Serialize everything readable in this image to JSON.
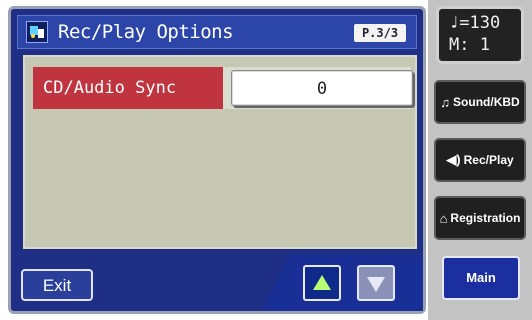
{
  "screen": {
    "title": "Rec/Play Options",
    "page_indicator": "P.3/3",
    "title_icon": "recorder-icon"
  },
  "params": [
    {
      "label": "CD/Audio Sync",
      "value": "0"
    }
  ],
  "bottom": {
    "exit_label": "Exit",
    "up_icon": "arrow-up-icon",
    "down_icon": "arrow-down-icon"
  },
  "side": {
    "tempo": "♩=130",
    "measure": "M:   1",
    "buttons": [
      {
        "label": "Sound/KBD",
        "icon": "♫"
      },
      {
        "label": "Rec/Play",
        "icon": "◀)"
      },
      {
        "label": "Registration",
        "icon": "⌂"
      }
    ],
    "main_label": "Main"
  },
  "colors": {
    "lcd_bg": "#1f2f86",
    "content_bg": "#c6c8b3",
    "label_red": "#c0343f",
    "up_arrow": "#b9ff75"
  }
}
